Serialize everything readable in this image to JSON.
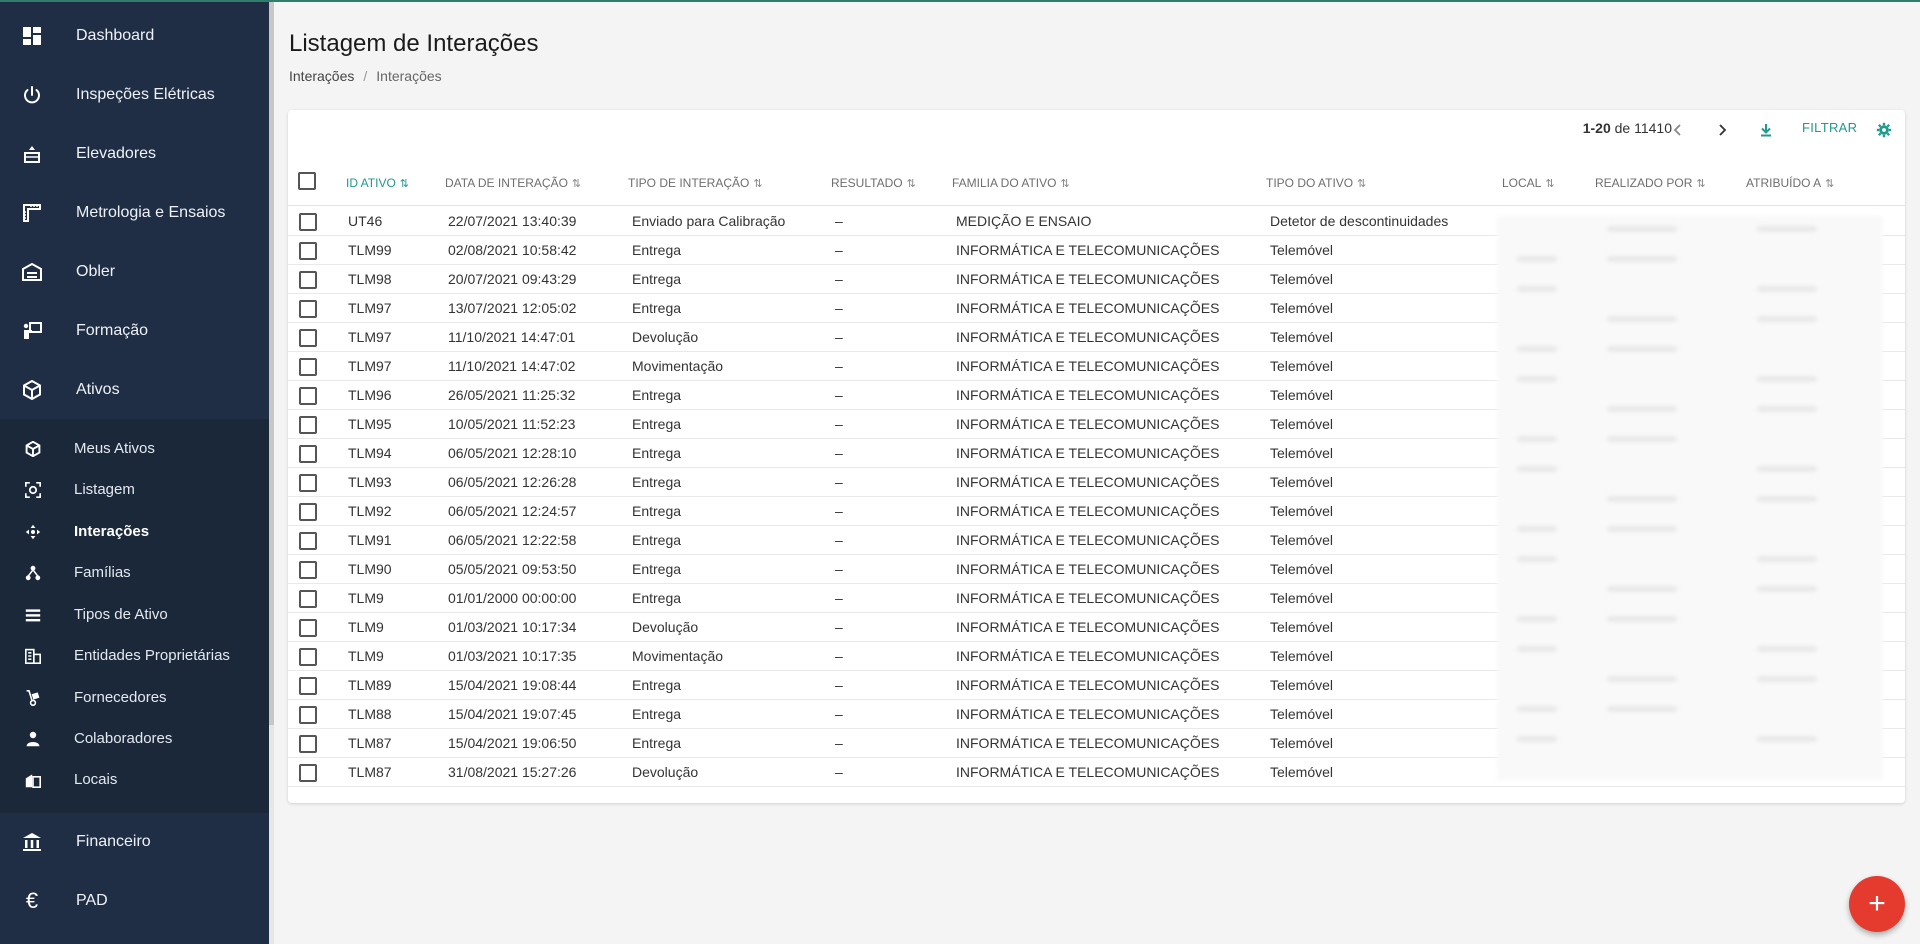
{
  "sidebar": {
    "items": [
      {
        "label": "Dashboard",
        "icon": "dashboard-icon"
      },
      {
        "label": "Inspeções Elétricas",
        "icon": "power-icon"
      },
      {
        "label": "Elevadores",
        "icon": "elevator-icon"
      },
      {
        "label": "Metrologia e Ensaios",
        "icon": "ruler-icon"
      },
      {
        "label": "Obler",
        "icon": "warehouse-icon"
      },
      {
        "label": "Formação",
        "icon": "teacher-icon"
      },
      {
        "label": "Ativos",
        "icon": "cube-icon"
      }
    ],
    "subitems": [
      {
        "label": "Meus Ativos",
        "icon": "cube-small-icon"
      },
      {
        "label": "Listagem",
        "icon": "scan-icon"
      },
      {
        "label": "Interações",
        "icon": "move-icon",
        "active": true
      },
      {
        "label": "Famílias",
        "icon": "hierarchy-icon"
      },
      {
        "label": "Tipos de Ativo",
        "icon": "list-icon"
      },
      {
        "label": "Entidades Proprietárias",
        "icon": "building-icon"
      },
      {
        "label": "Fornecedores",
        "icon": "dolly-icon"
      },
      {
        "label": "Colaboradores",
        "icon": "person-icon"
      },
      {
        "label": "Locais",
        "icon": "location-building-icon"
      }
    ],
    "bottom": [
      {
        "label": "Financeiro",
        "icon": "bank-icon"
      },
      {
        "label": "PAD",
        "icon": "euro-icon"
      }
    ]
  },
  "header": {
    "title": "Listagem de Interações",
    "breadcrumb": [
      "Interações",
      "Interações"
    ]
  },
  "toolbar": {
    "range": "1-20",
    "of": "de",
    "total": "11410",
    "filter_label": "FILTRAR"
  },
  "table": {
    "columns": [
      "ID ATIVO",
      "DATA DE INTERAÇÃO",
      "TIPO DE INTERAÇÃO",
      "RESULTADO",
      "FAMILIA DO ATIVO",
      "TIPO DO ATIVO",
      "LOCAL",
      "REALIZADO POR",
      "ATRIBUÍDO A"
    ],
    "sort_icon": "sort-icon",
    "rows": [
      [
        "UT46",
        "22/07/2021 13:40:39",
        "Enviado para Calibração",
        "–",
        "MEDIÇÃO E ENSAIO",
        "Detetor de descontinuidades"
      ],
      [
        "TLM99",
        "02/08/2021 10:58:42",
        "Entrega",
        "–",
        "INFORMÁTICA E TELECOMUNICAÇÕES",
        "Telemóvel"
      ],
      [
        "TLM98",
        "20/07/2021 09:43:29",
        "Entrega",
        "–",
        "INFORMÁTICA E TELECOMUNICAÇÕES",
        "Telemóvel"
      ],
      [
        "TLM97",
        "13/07/2021 12:05:02",
        "Entrega",
        "–",
        "INFORMÁTICA E TELECOMUNICAÇÕES",
        "Telemóvel"
      ],
      [
        "TLM97",
        "11/10/2021 14:47:01",
        "Devolução",
        "–",
        "INFORMÁTICA E TELECOMUNICAÇÕES",
        "Telemóvel"
      ],
      [
        "TLM97",
        "11/10/2021 14:47:02",
        "Movimentação",
        "–",
        "INFORMÁTICA E TELECOMUNICAÇÕES",
        "Telemóvel"
      ],
      [
        "TLM96",
        "26/05/2021 11:25:32",
        "Entrega",
        "–",
        "INFORMÁTICA E TELECOMUNICAÇÕES",
        "Telemóvel"
      ],
      [
        "TLM95",
        "10/05/2021 11:52:23",
        "Entrega",
        "–",
        "INFORMÁTICA E TELECOMUNICAÇÕES",
        "Telemóvel"
      ],
      [
        "TLM94",
        "06/05/2021 12:28:10",
        "Entrega",
        "–",
        "INFORMÁTICA E TELECOMUNICAÇÕES",
        "Telemóvel"
      ],
      [
        "TLM93",
        "06/05/2021 12:26:28",
        "Entrega",
        "–",
        "INFORMÁTICA E TELECOMUNICAÇÕES",
        "Telemóvel"
      ],
      [
        "TLM92",
        "06/05/2021 12:24:57",
        "Entrega",
        "–",
        "INFORMÁTICA E TELECOMUNICAÇÕES",
        "Telemóvel"
      ],
      [
        "TLM91",
        "06/05/2021 12:22:58",
        "Entrega",
        "–",
        "INFORMÁTICA E TELECOMUNICAÇÕES",
        "Telemóvel"
      ],
      [
        "TLM90",
        "05/05/2021 09:53:50",
        "Entrega",
        "–",
        "INFORMÁTICA E TELECOMUNICAÇÕES",
        "Telemóvel"
      ],
      [
        "TLM9",
        "01/01/2000 00:00:00",
        "Entrega",
        "–",
        "INFORMÁTICA E TELECOMUNICAÇÕES",
        "Telemóvel"
      ],
      [
        "TLM9",
        "01/03/2021 10:17:34",
        "Devolução",
        "–",
        "INFORMÁTICA E TELECOMUNICAÇÕES",
        "Telemóvel"
      ],
      [
        "TLM9",
        "01/03/2021 10:17:35",
        "Movimentação",
        "–",
        "INFORMÁTICA E TELECOMUNICAÇÕES",
        "Telemóvel"
      ],
      [
        "TLM89",
        "15/04/2021 19:08:44",
        "Entrega",
        "–",
        "INFORMÁTICA E TELECOMUNICAÇÕES",
        "Telemóvel"
      ],
      [
        "TLM88",
        "15/04/2021 19:07:45",
        "Entrega",
        "–",
        "INFORMÁTICA E TELECOMUNICAÇÕES",
        "Telemóvel"
      ],
      [
        "TLM87",
        "15/04/2021 19:06:50",
        "Entrega",
        "–",
        "INFORMÁTICA E TELECOMUNICAÇÕES",
        "Telemóvel"
      ],
      [
        "TLM87",
        "31/08/2021 15:27:26",
        "Devolução",
        "–",
        "INFORMÁTICA E TELECOMUNICAÇÕES",
        "Telemóvel"
      ]
    ]
  },
  "fab": {
    "label": "+",
    "icon": "add-icon"
  },
  "colors": {
    "sidebar": "#1f2e45",
    "accent": "#1f9a8c",
    "fab": "#e53b2f"
  }
}
